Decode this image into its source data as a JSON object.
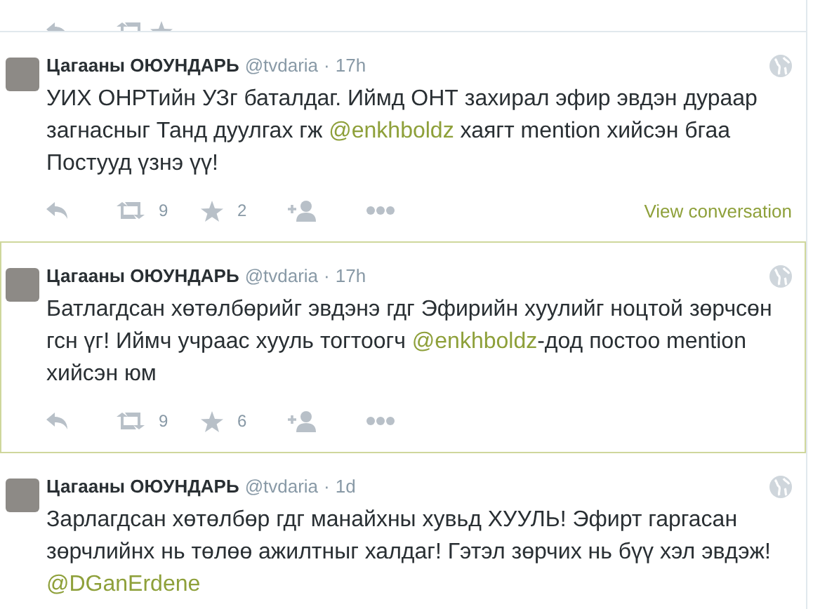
{
  "tweets": [
    {
      "name": "Цагааны ОЮУНДАРЬ",
      "handle": "@tvdaria",
      "separator": "·",
      "time": "17h",
      "highlighted": false,
      "text": [
        {
          "kind": "text",
          "s": "УИХ ОНРТийн УЗг баталдаг. Иймд ОНТ захирал эфир эвдэн дураар загнасныг Танд дуулгах гж "
        },
        {
          "kind": "mention",
          "s": "@enkhboldz"
        },
        {
          "kind": "text",
          "s": " хаягт mention хийсэн бгаа Постууд үзнэ үү!"
        }
      ],
      "retweets": "9",
      "favorites": "2",
      "view_conversation": "View conversation"
    },
    {
      "name": "Цагааны ОЮУНДАРЬ",
      "handle": "@tvdaria",
      "separator": "·",
      "time": "17h",
      "highlighted": true,
      "text": [
        {
          "kind": "text",
          "s": "Батлагдсан хөтөлбөрийг эвдэнэ гдг Эфирийн хуулийг ноцтой зөрчсөн гсн үг! Иймч учраас хууль тогтоогч "
        },
        {
          "kind": "mention",
          "s": "@enkhboldz"
        },
        {
          "kind": "text",
          "s": "-дод постоо mention хийсэн юм"
        }
      ],
      "retweets": "9",
      "favorites": "6"
    },
    {
      "name": "Цагааны ОЮУНДАРЬ",
      "handle": "@tvdaria",
      "separator": "·",
      "time": "1d",
      "highlighted": false,
      "text": [
        {
          "kind": "text",
          "s": "Зарлагдсан хөтөлбөр гдг манайхны хувьд ХУУЛЬ! Эфирт гаргасан зөрчлийнх нь төлөө ажилтныг халдаг! Гэтэл зөрчих нь бүү хэл эвдэж! "
        },
        {
          "kind": "mention",
          "s": "@DGanErdene"
        }
      ]
    }
  ]
}
